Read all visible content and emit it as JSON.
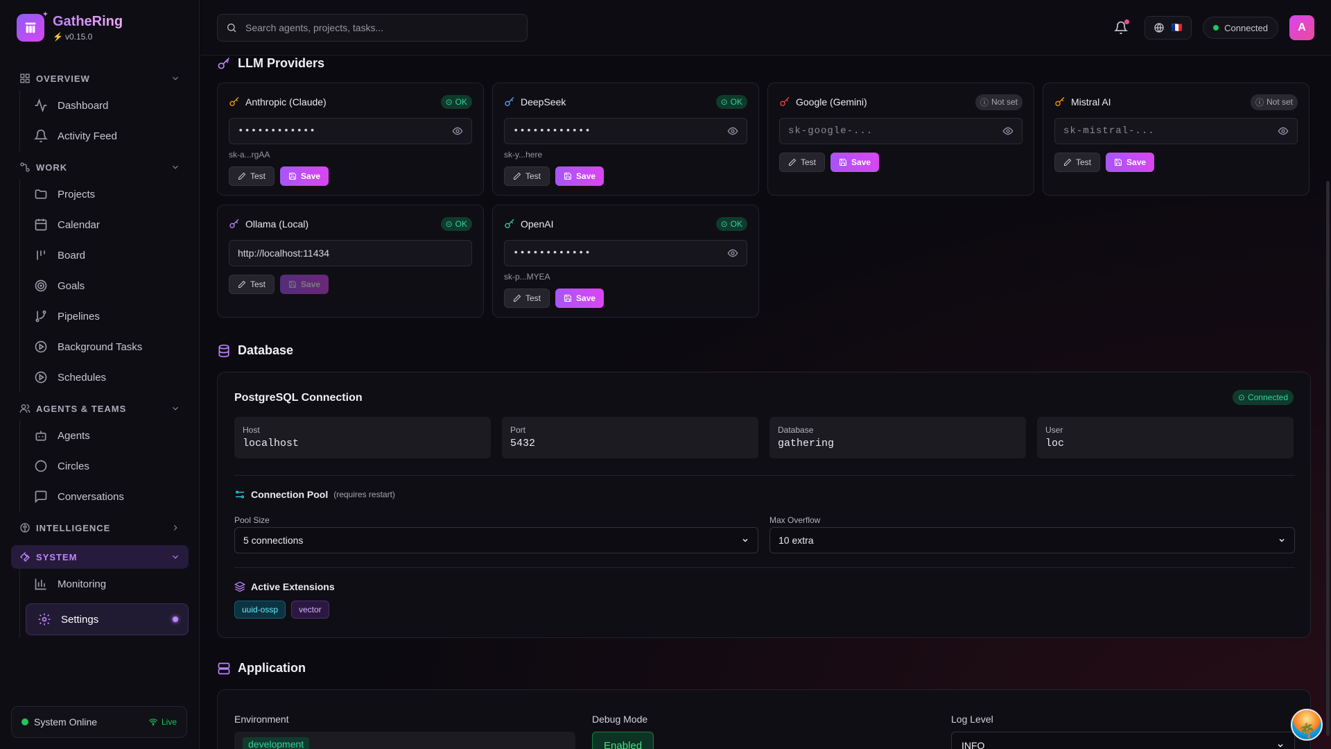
{
  "app": {
    "name": "GatheRing",
    "version": "v0.15.0"
  },
  "sidebar": {
    "sections": [
      {
        "title": "OVERVIEW",
        "items": [
          {
            "label": "Dashboard"
          },
          {
            "label": "Activity Feed"
          }
        ]
      },
      {
        "title": "WORK",
        "items": [
          {
            "label": "Projects"
          },
          {
            "label": "Calendar"
          },
          {
            "label": "Board"
          },
          {
            "label": "Goals"
          },
          {
            "label": "Pipelines"
          },
          {
            "label": "Background Tasks"
          },
          {
            "label": "Schedules"
          }
        ]
      },
      {
        "title": "AGENTS & TEAMS",
        "items": [
          {
            "label": "Agents"
          },
          {
            "label": "Circles"
          },
          {
            "label": "Conversations"
          }
        ]
      },
      {
        "title": "INTELLIGENCE"
      },
      {
        "title": "SYSTEM",
        "items": [
          {
            "label": "Monitoring"
          },
          {
            "label": "Settings"
          }
        ]
      }
    ],
    "status": {
      "label": "System Online",
      "live": "Live"
    }
  },
  "topbar": {
    "search_placeholder": "Search agents, projects, tasks...",
    "connection": "Connected",
    "avatar": "A",
    "flag": "🇫🇷"
  },
  "llm": {
    "title": "LLM Providers",
    "providers": [
      {
        "name": "Anthropic (Claude)",
        "status": "OK",
        "value": "••••••••••••",
        "hint": "sk-a...rgAA",
        "test": "Test",
        "save": "Save",
        "color": "#f59e0b"
      },
      {
        "name": "DeepSeek",
        "status": "OK",
        "value": "••••••••••••",
        "hint": "sk-y...here",
        "test": "Test",
        "save": "Save",
        "color": "#60a5fa"
      },
      {
        "name": "Google (Gemini)",
        "status": "Not set",
        "placeholder": "sk-google-...",
        "test": "Test",
        "save": "Save",
        "color": "#ef4444"
      },
      {
        "name": "Mistral AI",
        "status": "Not set",
        "placeholder": "sk-mistral-...",
        "test": "Test",
        "save": "Save",
        "color": "#f59e0b"
      },
      {
        "name": "Ollama (Local)",
        "status": "OK",
        "value": "http://localhost:11434",
        "test": "Test",
        "save": "Save",
        "color": "#c084fc"
      },
      {
        "name": "OpenAI",
        "status": "OK",
        "value": "••••••••••••",
        "hint": "sk-p...MYEA",
        "test": "Test",
        "save": "Save",
        "color": "#34d399"
      }
    ]
  },
  "database": {
    "title": "Database",
    "card_title": "PostgreSQL Connection",
    "status": "Connected",
    "fields": [
      {
        "label": "Host",
        "value": "localhost"
      },
      {
        "label": "Port",
        "value": "5432"
      },
      {
        "label": "Database",
        "value": "gathering"
      },
      {
        "label": "User",
        "value": "loc"
      }
    ],
    "pool": {
      "title": "Connection Pool",
      "note": "(requires restart)",
      "size_label": "Pool Size",
      "size_value": "5 connections",
      "overflow_label": "Max Overflow",
      "overflow_value": "10 extra"
    },
    "extensions": {
      "title": "Active Extensions",
      "items": [
        "uuid-ossp",
        "vector"
      ]
    }
  },
  "application": {
    "title": "Application",
    "env_label": "Environment",
    "env_value": "development",
    "debug_label": "Debug Mode",
    "debug_value": "Enabled",
    "log_label": "Log Level",
    "log_value": "INFO"
  }
}
